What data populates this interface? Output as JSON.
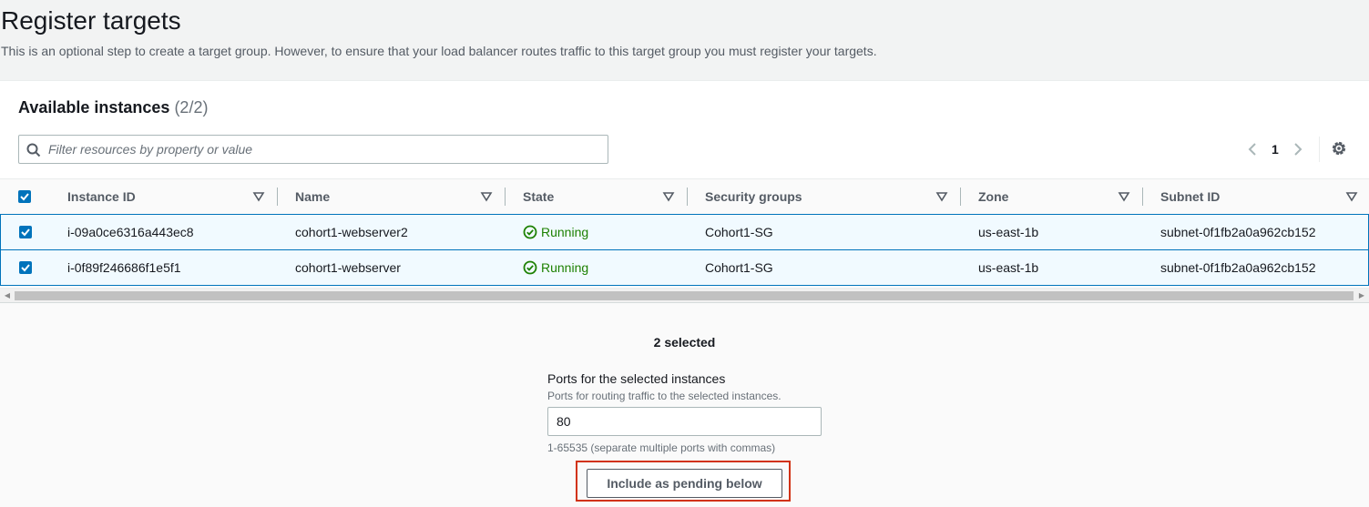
{
  "header": {
    "title": "Register targets",
    "description": "This is an optional step to create a target group. However, to ensure that your load balancer routes traffic to this target group you must register your targets."
  },
  "instances": {
    "title": "Available instances",
    "count": "(2/2)",
    "search_placeholder": "Filter resources by property or value",
    "page": "1",
    "columns": [
      "Instance ID",
      "Name",
      "State",
      "Security groups",
      "Zone",
      "Subnet ID"
    ],
    "rows": [
      {
        "instance_id": "i-09a0ce6316a443ec8",
        "name": "cohort1-webserver2",
        "state": "Running",
        "security_groups": "Cohort1-SG",
        "zone": "us-east-1b",
        "subnet_id": "subnet-0f1fb2a0a962cb152"
      },
      {
        "instance_id": "i-0f89f246686f1e5f1",
        "name": "cohort1-webserver",
        "state": "Running",
        "security_groups": "Cohort1-SG",
        "zone": "us-east-1b",
        "subnet_id": "subnet-0f1fb2a0a962cb152"
      }
    ]
  },
  "selection": {
    "summary": "2 selected",
    "ports_label": "Ports for the selected instances",
    "ports_description": "Ports for routing traffic to the selected instances.",
    "ports_value": "80",
    "ports_hint": "1-65535 (separate multiple ports with commas)",
    "include_button": "Include as pending below"
  },
  "colors": {
    "running": "#1d8102",
    "selected_row_bg": "#f1faff",
    "selected_border": "#0073bb",
    "highlight": "#d13212"
  }
}
